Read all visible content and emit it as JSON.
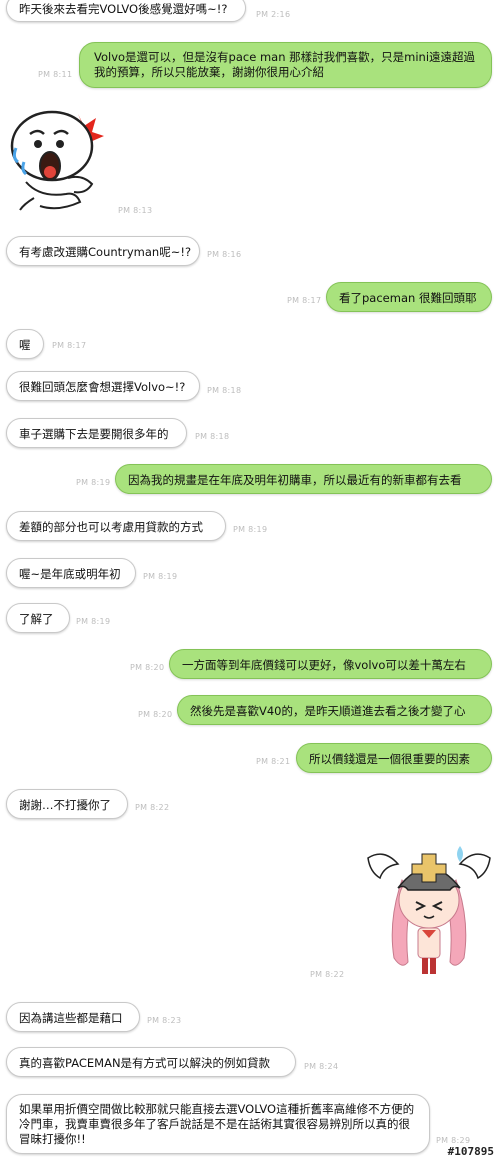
{
  "messages": [
    {
      "text": "昨天後來去看完VOLVO後感覺還好嗎~!?",
      "time": "PM 2:16"
    },
    {
      "text": "Volvo是還可以，但是沒有pace man 那樣討我們喜歡，只是mini遠遠超過我的預算，所以只能放棄，謝謝你很用心介紹",
      "time": "PM 8:11"
    },
    {
      "text": "",
      "time": "PM 8:13"
    },
    {
      "text": "有考慮改選購Countryman呢~!?",
      "time": "PM 8:16"
    },
    {
      "text": "看了paceman 很難回頭耶",
      "time": "PM 8:17"
    },
    {
      "text": "喔",
      "time": "PM 8:17"
    },
    {
      "text": "很難回頭怎麼會想選擇Volvo~!?",
      "time": "PM 8:18"
    },
    {
      "text": "車子選購下去是要開很多年的",
      "time": "PM 8:18"
    },
    {
      "text": "因為我的規畫是在年底及明年初購車，所以最近有的新車都有去看",
      "time": "PM 8:19"
    },
    {
      "text": "差額的部分也可以考慮用貸款的方式",
      "time": "PM 8:19"
    },
    {
      "text": "喔~是年底或明年初",
      "time": "PM 8:19"
    },
    {
      "text": "了解了",
      "time": "PM 8:19"
    },
    {
      "text": "一方面等到年底價錢可以更好，像volvo可以差十萬左右",
      "time": "PM 8:20"
    },
    {
      "text": "然後先是喜歡V40的，是昨天順道進去看之後才變了心",
      "time": "PM 8:20"
    },
    {
      "text": "所以價錢還是一個很重要的因素",
      "time": "PM 8:21"
    },
    {
      "text": "謝謝…不打擾你了",
      "time": "PM 8:22"
    },
    {
      "text": "",
      "time": "PM 8:22"
    },
    {
      "text": "因為講這些都是藉口",
      "time": "PM 8:23"
    },
    {
      "text": "真的喜歡PACEMAN是有方式可以解決的例如貸款",
      "time": "PM 8:24"
    },
    {
      "text": "如果單用折價空間做比較那就只能直接去選VOLVO這種折舊率高維修不方便的冷門車，我賣車賣很多年了客戶說話是不是在話術其實很容易辨別所以真的很冒昧打擾你!!",
      "time": "PM 8:29"
    }
  ],
  "watermark": "#107895"
}
